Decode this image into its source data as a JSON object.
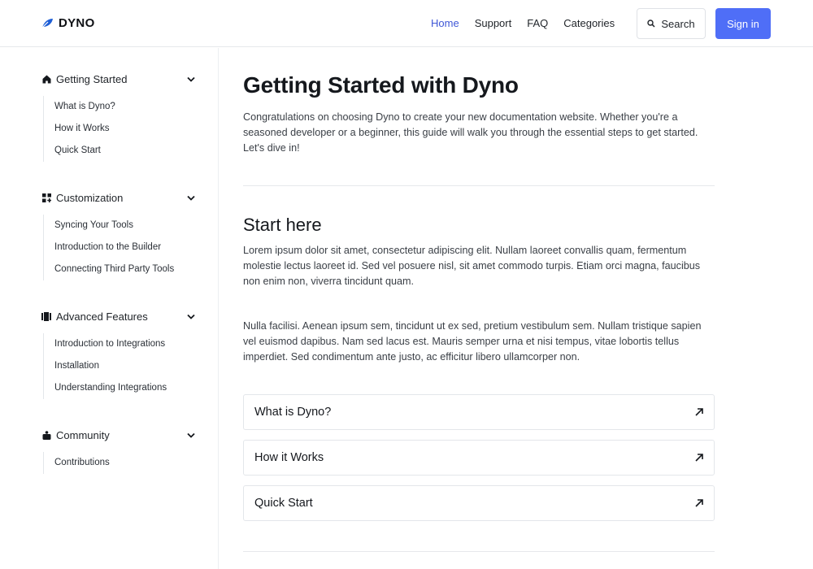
{
  "brand": {
    "name": "DYNO",
    "accent": "#4f6ef7"
  },
  "nav": {
    "items": [
      {
        "label": "Home",
        "active": true
      },
      {
        "label": "Support",
        "active": false
      },
      {
        "label": "FAQ",
        "active": false
      },
      {
        "label": "Categories",
        "active": false
      }
    ],
    "search_label": "Search",
    "signin_label": "Sign in"
  },
  "sidebar": {
    "sections": [
      {
        "icon": "home-icon",
        "title": "Getting Started",
        "items": [
          "What is Dyno?",
          "How it Works",
          "Quick Start"
        ]
      },
      {
        "icon": "grid-plus-icon",
        "title": "Customization",
        "items": [
          "Syncing Your Tools",
          "Introduction to the Builder",
          "Connecting Third Party Tools"
        ]
      },
      {
        "icon": "book-icon",
        "title": "Advanced Features",
        "items": [
          "Introduction to Integrations",
          "Installation",
          "Understanding Integrations"
        ]
      },
      {
        "icon": "community-icon",
        "title": "Community",
        "items": [
          "Contributions"
        ]
      }
    ]
  },
  "main": {
    "title": "Getting Started with Dyno",
    "intro": "Congratulations on choosing Dyno to create your new documentation website. Whether you're a seasoned developer or a beginner, this guide will walk you through the essential steps to get started. Let's dive in!",
    "section_title": "Start here",
    "paragraphs": [
      "Lorem ipsum dolor sit amet, consectetur adipiscing elit. Nullam laoreet convallis quam, fermentum molestie lectus laoreet id. Sed vel posuere nisl, sit amet commodo turpis. Etiam orci magna, faucibus non enim non, viverra tincidunt quam.",
      "Nulla facilisi. Aenean ipsum sem, tincidunt ut ex sed, pretium vestibulum sem. Nullam tristique sapien vel euismod dapibus. Nam sed lacus est. Mauris semper urna et nisi tempus, vitae lobortis tellus imperdiet. Sed condimentum ante justo, ac efficitur libero ullamcorper non."
    ],
    "cards": [
      {
        "label": "What is Dyno?"
      },
      {
        "label": "How it Works"
      },
      {
        "label": "Quick Start"
      }
    ]
  }
}
